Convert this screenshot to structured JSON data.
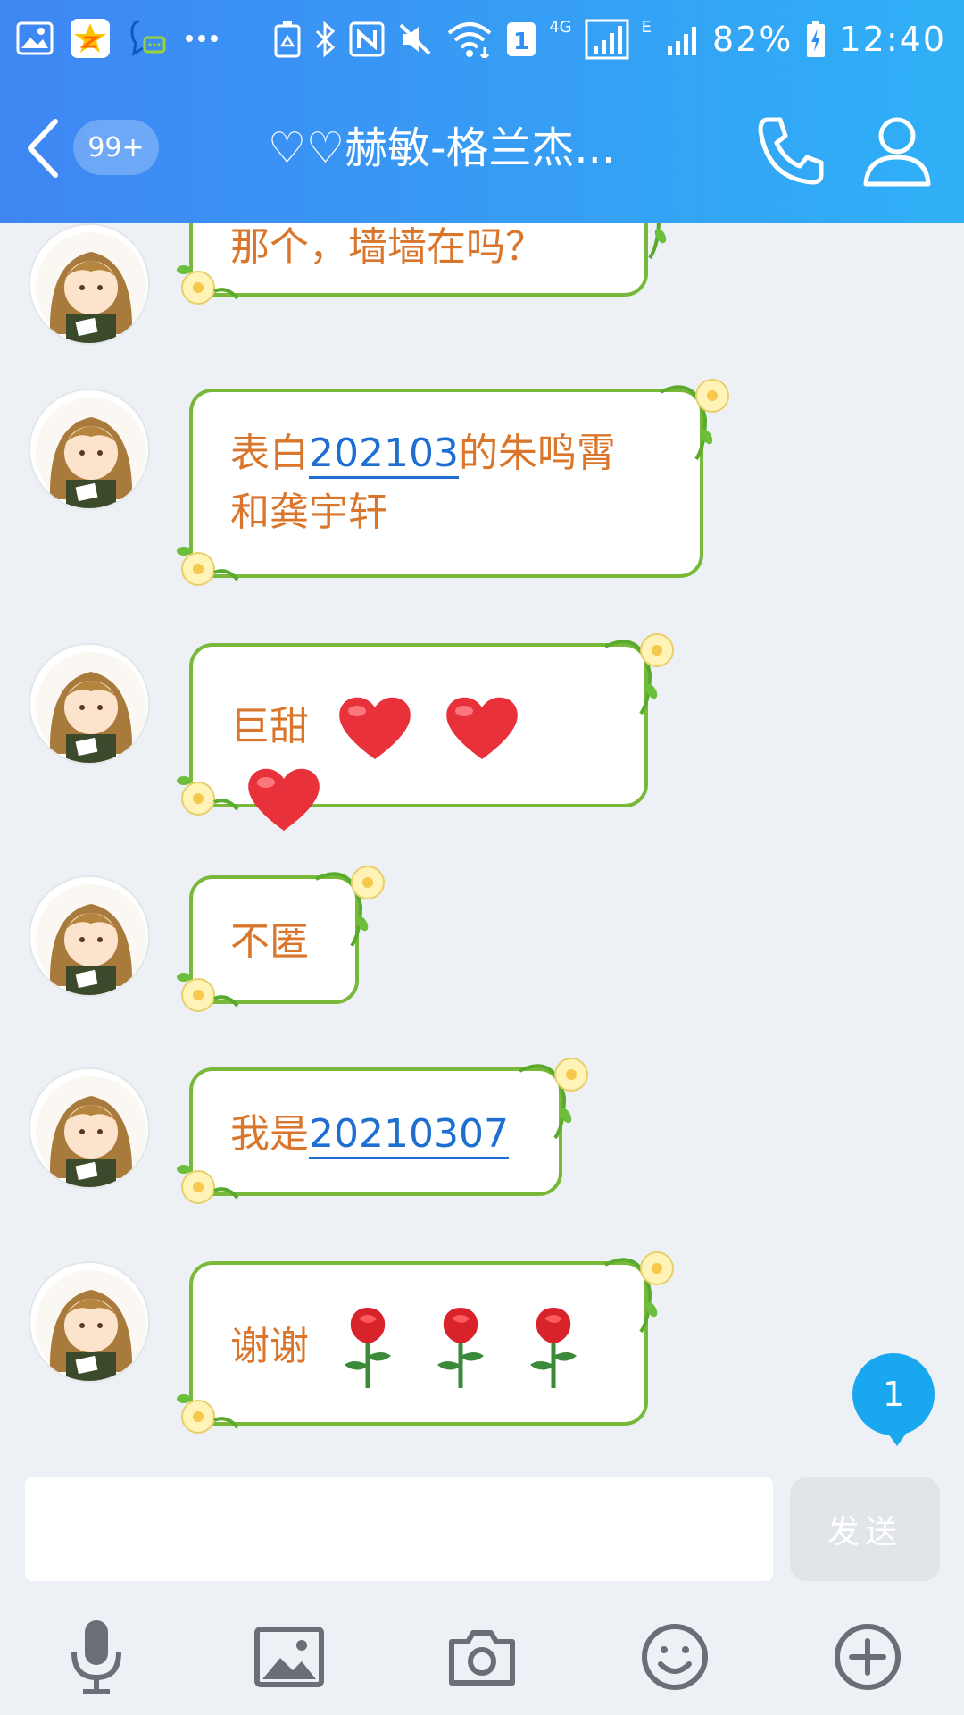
{
  "status_bar": {
    "battery": "82%",
    "time": "12:40",
    "network_4g": "4G",
    "network_e": "E",
    "sim_slot": "1",
    "icons": [
      "gallery-icon",
      "qzone-star-icon",
      "qq-message-icon",
      "more-dots-icon",
      "recycle-icon",
      "bluetooth-icon",
      "nfc-icon",
      "mute-icon",
      "wifi-icon",
      "signal-icon",
      "battery-charging-icon"
    ]
  },
  "header": {
    "title": "♡♡赫敏-格兰杰...",
    "unread_count": "99+",
    "background_gradient": [
      "#3f86f3",
      "#2fb0f6"
    ]
  },
  "messages": [
    {
      "text": "那个，墙墙在吗？"
    },
    {
      "before": "表白",
      "link": "202103",
      "after": "的朱鸣霄",
      "line2": "和龚宇轩"
    },
    {
      "text": "巨甜",
      "emoji": [
        "heart",
        "heart",
        "heart"
      ]
    },
    {
      "text": "不匿"
    },
    {
      "before": "我是",
      "link": "20210307"
    },
    {
      "text": "谢谢",
      "emoji": [
        "rose",
        "rose",
        "rose"
      ]
    }
  ],
  "unread_new": "1",
  "input": {
    "value": "",
    "placeholder": ""
  },
  "send_label": "发送",
  "toolbar": [
    "microphone-icon",
    "image-icon",
    "camera-icon",
    "emoji-icon",
    "plus-icon"
  ],
  "colors": {
    "bubble_text": "#d9762c",
    "bubble_border": "#78b93a",
    "link": "#1e6fd1",
    "chat_bg": "#edf1f6"
  }
}
